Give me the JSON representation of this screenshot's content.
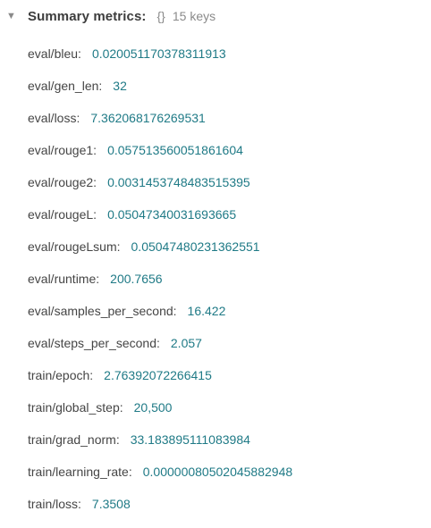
{
  "header": {
    "title": "Summary metrics:",
    "braces": "{}",
    "count": "15 keys",
    "caret": "▼"
  },
  "metrics": [
    {
      "key": "eval/bleu",
      "value": "0.020051170378311913"
    },
    {
      "key": "eval/gen_len",
      "value": "32"
    },
    {
      "key": "eval/loss",
      "value": "7.362068176269531"
    },
    {
      "key": "eval/rouge1",
      "value": "0.057513560051861604"
    },
    {
      "key": "eval/rouge2",
      "value": "0.0031453748483515395"
    },
    {
      "key": "eval/rougeL",
      "value": "0.05047340031693665"
    },
    {
      "key": "eval/rougeLsum",
      "value": "0.05047480231362551"
    },
    {
      "key": "eval/runtime",
      "value": "200.7656"
    },
    {
      "key": "eval/samples_per_second",
      "value": "16.422"
    },
    {
      "key": "eval/steps_per_second",
      "value": "2.057"
    },
    {
      "key": "train/epoch",
      "value": "2.76392072266415"
    },
    {
      "key": "train/global_step",
      "value": "20,500"
    },
    {
      "key": "train/grad_norm",
      "value": "33.183895111083984"
    },
    {
      "key": "train/learning_rate",
      "value": "0.00000080502045882948"
    },
    {
      "key": "train/loss",
      "value": "7.3508"
    }
  ]
}
